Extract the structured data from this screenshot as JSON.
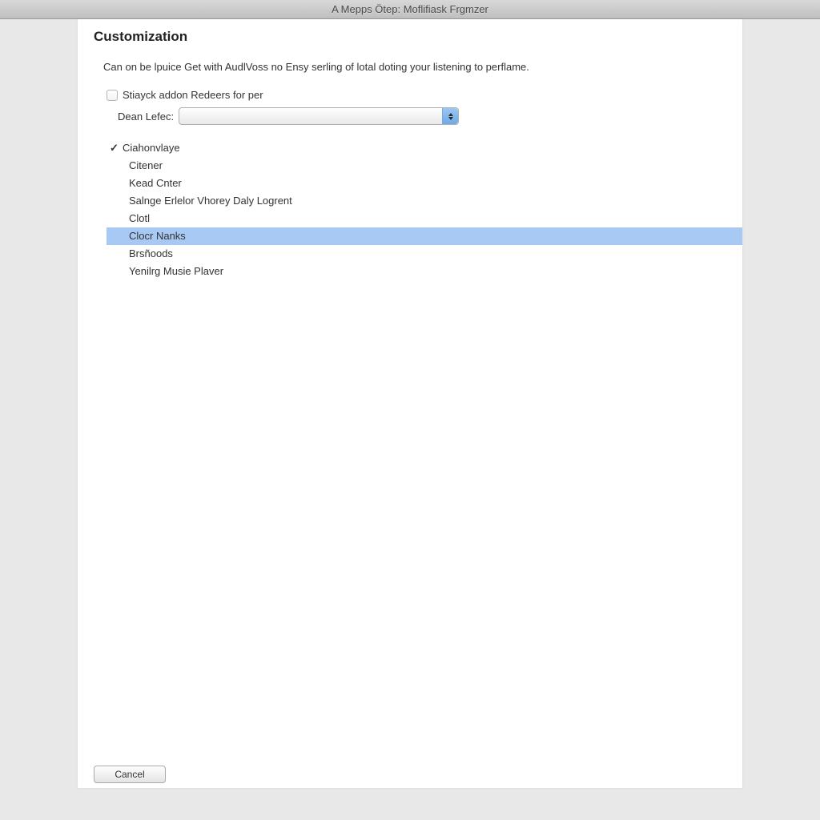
{
  "window": {
    "title": "A Mepps Ötep: Moflifiask Frgmzer"
  },
  "page": {
    "heading": "Customization",
    "description": "Can on be lpuice Get with AudlVoss no Ensy serling of lotal doting your listening to perflame."
  },
  "checkbox": {
    "label": "Stiayck addon Redeers for per",
    "checked": false
  },
  "select": {
    "label": "Dean Lefec:",
    "value": ""
  },
  "tree": {
    "parent": {
      "label": "Ciahonvlaye",
      "checked": true
    },
    "children": [
      {
        "label": "Citener",
        "selected": false
      },
      {
        "label": "Kead Cnter",
        "selected": false
      },
      {
        "label": "Salnge Erlelor Vhorey Daly Logrent",
        "selected": false
      },
      {
        "label": "Clotl",
        "selected": false
      },
      {
        "label": "Clocr Nanks",
        "selected": true
      },
      {
        "label": "Brsñoods",
        "selected": false
      },
      {
        "label": "Yenilrg Musie Plaver",
        "selected": false
      }
    ]
  },
  "buttons": {
    "cancel": "Cancel"
  }
}
